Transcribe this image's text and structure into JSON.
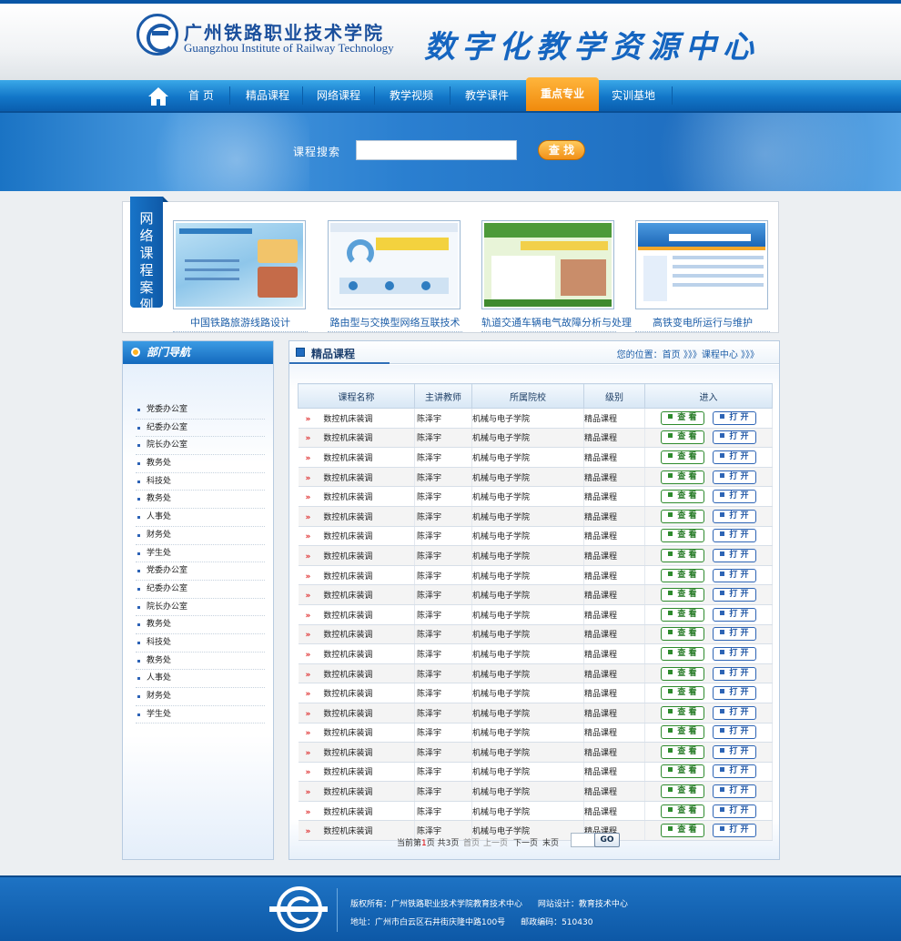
{
  "header": {
    "school_cn": "广州铁路职业技术学院",
    "school_en": "Guangzhou Institute of Railway Technology",
    "site_title": "数字化教学资源中心"
  },
  "nav": {
    "items": [
      {
        "label": "首 页"
      },
      {
        "label": "精品课程"
      },
      {
        "label": "网络课程"
      },
      {
        "label": "教学视频"
      },
      {
        "label": "教学课件"
      },
      {
        "label": "重点专业",
        "active": true
      },
      {
        "label": "实训基地"
      }
    ]
  },
  "search": {
    "label": "课程搜索",
    "value": "",
    "button": "查 找"
  },
  "cases": {
    "tab_label": "网络课程案例",
    "items": [
      {
        "title": "中国铁路旅游线路设计"
      },
      {
        "title": "路由型与交换型网络互联技术"
      },
      {
        "title": "轨道交通车辆电气故障分析与处理"
      },
      {
        "title": "高铁变电所运行与维护"
      }
    ]
  },
  "sidebar": {
    "title": "部门导航",
    "items": [
      {
        "label": "党委办公室"
      },
      {
        "label": "纪委办公室"
      },
      {
        "label": "院长办公室"
      },
      {
        "label": "教务处"
      },
      {
        "label": "科技处"
      },
      {
        "label": "教务处"
      },
      {
        "label": "人事处"
      },
      {
        "label": "财务处"
      },
      {
        "label": "学生处"
      },
      {
        "label": "党委办公室"
      },
      {
        "label": "纪委办公室"
      },
      {
        "label": "院长办公室"
      },
      {
        "label": "教务处"
      },
      {
        "label": "科技处"
      },
      {
        "label": "教务处"
      },
      {
        "label": "人事处"
      },
      {
        "label": "财务处"
      },
      {
        "label": "学生处"
      }
    ]
  },
  "main": {
    "title": "精品课程",
    "location": "您的位置：首页 》》》课程中心 》》》",
    "columns": [
      "课程名称",
      "主讲教师",
      "所属院校",
      "级别",
      "进入"
    ],
    "rows": [
      {
        "name": "数控机床装调",
        "teacher": "陈泽宇",
        "college": "机械与电子学院",
        "level": "精品课程"
      },
      {
        "name": "数控机床装调",
        "teacher": "陈泽宇",
        "college": "机械与电子学院",
        "level": "精品课程"
      },
      {
        "name": "数控机床装调",
        "teacher": "陈泽宇",
        "college": "机械与电子学院",
        "level": "精品课程"
      },
      {
        "name": "数控机床装调",
        "teacher": "陈泽宇",
        "college": "机械与电子学院",
        "level": "精品课程"
      },
      {
        "name": "数控机床装调",
        "teacher": "陈泽宇",
        "college": "机械与电子学院",
        "level": "精品课程"
      },
      {
        "name": "数控机床装调",
        "teacher": "陈泽宇",
        "college": "机械与电子学院",
        "level": "精品课程"
      },
      {
        "name": "数控机床装调",
        "teacher": "陈泽宇",
        "college": "机械与电子学院",
        "level": "精品课程"
      },
      {
        "name": "数控机床装调",
        "teacher": "陈泽宇",
        "college": "机械与电子学院",
        "level": "精品课程"
      },
      {
        "name": "数控机床装调",
        "teacher": "陈泽宇",
        "college": "机械与电子学院",
        "level": "精品课程"
      },
      {
        "name": "数控机床装调",
        "teacher": "陈泽宇",
        "college": "机械与电子学院",
        "level": "精品课程"
      },
      {
        "name": "数控机床装调",
        "teacher": "陈泽宇",
        "college": "机械与电子学院",
        "level": "精品课程"
      },
      {
        "name": "数控机床装调",
        "teacher": "陈泽宇",
        "college": "机械与电子学院",
        "level": "精品课程"
      },
      {
        "name": "数控机床装调",
        "teacher": "陈泽宇",
        "college": "机械与电子学院",
        "level": "精品课程"
      },
      {
        "name": "数控机床装调",
        "teacher": "陈泽宇",
        "college": "机械与电子学院",
        "level": "精品课程"
      },
      {
        "name": "数控机床装调",
        "teacher": "陈泽宇",
        "college": "机械与电子学院",
        "level": "精品课程"
      },
      {
        "name": "数控机床装调",
        "teacher": "陈泽宇",
        "college": "机械与电子学院",
        "level": "精品课程"
      },
      {
        "name": "数控机床装调",
        "teacher": "陈泽宇",
        "college": "机械与电子学院",
        "level": "精品课程"
      },
      {
        "name": "数控机床装调",
        "teacher": "陈泽宇",
        "college": "机械与电子学院",
        "level": "精品课程"
      },
      {
        "name": "数控机床装调",
        "teacher": "陈泽宇",
        "college": "机械与电子学院",
        "level": "精品课程"
      },
      {
        "name": "数控机床装调",
        "teacher": "陈泽宇",
        "college": "机械与电子学院",
        "level": "精品课程"
      },
      {
        "name": "数控机床装调",
        "teacher": "陈泽宇",
        "college": "机械与电子学院",
        "level": "精品课程"
      },
      {
        "name": "数控机床装调",
        "teacher": "陈泽宇",
        "college": "机械与电子学院",
        "level": "精品课程"
      }
    ],
    "view_label": "查 看",
    "open_label": "打 开",
    "pager": {
      "status_prefix": "当前第",
      "current_page": "1",
      "status_mid": "页 共",
      "total_pages": "3",
      "status_suffix": "页",
      "first": "首页",
      "prev": "上一页",
      "next": "下一页",
      "last": "末页",
      "go": "GO"
    }
  },
  "footer": {
    "copyright": "版权所有：广州铁路职业技术学院教育技术中心",
    "design": "网站设计：教育技术中心",
    "address": "地址：广州市白云区石井街庆隆中路100号",
    "postcode": "邮政编码：510430"
  },
  "colors": {
    "brand_blue": "#1276c8",
    "active_tab_orange": "#f08a0c",
    "view_button_green": "#2d8a2d",
    "open_button_blue": "#2d64b5"
  }
}
